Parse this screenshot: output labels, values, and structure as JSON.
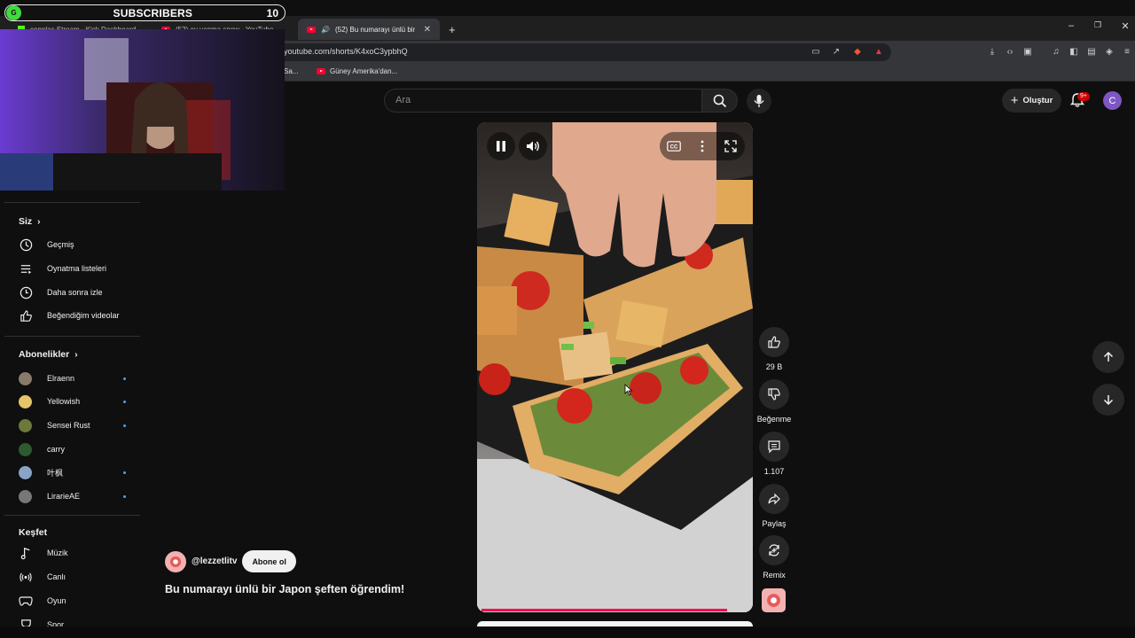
{
  "overlay": {
    "dot_text": "G",
    "label": "SUBSCRIBERS",
    "count": "10"
  },
  "tabs": [
    {
      "label": "cennlas Stream - Kick Dashboard",
      "icon": "kick-icon"
    },
    {
      "label": "(52) ev yapma spow - YouTube",
      "icon": "youtube-icon"
    },
    {
      "label": "(52) Bu numarayı ünlü bir Japo",
      "icon": "youtube-icon",
      "active": true
    }
  ],
  "url": "youtube.com/shorts/K4xoC3ypbhQ",
  "bookmarks": [
    {
      "label": "Sa..."
    },
    {
      "label": "Güney Amerika'dan..."
    }
  ],
  "header": {
    "search_placeholder": "Ara",
    "create_label": "Oluştur",
    "notif_badge": "9+",
    "avatar_letter": "C"
  },
  "sidebar": {
    "you_title": "Siz",
    "you_items": [
      {
        "label": "Geçmiş",
        "icon": "history-icon"
      },
      {
        "label": "Oynatma listeleri",
        "icon": "playlists-icon"
      },
      {
        "label": "Daha sonra izle",
        "icon": "watch-later-icon"
      },
      {
        "label": "Beğendiğim videolar",
        "icon": "liked-videos-icon"
      }
    ],
    "subs_title": "Abonelikler",
    "subscriptions": [
      {
        "label": "Elraenn",
        "color": "#8a7a6a",
        "live": true
      },
      {
        "label": "Yellowish",
        "color": "#e6c46a",
        "live": true
      },
      {
        "label": "Sensei Rust",
        "color": "#6b7a3a",
        "live": true
      },
      {
        "label": "carry",
        "color": "#2f5a2f",
        "live": false
      },
      {
        "label": "叶枫",
        "color": "#8aa3c8",
        "live": true
      },
      {
        "label": "LirarieAE",
        "color": "#777777",
        "live": true
      }
    ],
    "explore_title": "Keşfet",
    "explore_items": [
      {
        "label": "Müzik",
        "icon": "music-icon"
      },
      {
        "label": "Canlı",
        "icon": "live-icon"
      },
      {
        "label": "Oyun",
        "icon": "gaming-icon"
      },
      {
        "label": "Spor",
        "icon": "sports-icon"
      }
    ]
  },
  "short": {
    "playback_progress": 0.92,
    "channel": "@lezzetlitv",
    "subscribe_label": "Abone ol",
    "title": "Bu numarayı ünlü bir Japon şeften öğrendim!",
    "likes": "29 B",
    "dislike_label": "Beğenme",
    "comments": "1.107",
    "share_label": "Paylaş",
    "remix_label": "Remix"
  }
}
